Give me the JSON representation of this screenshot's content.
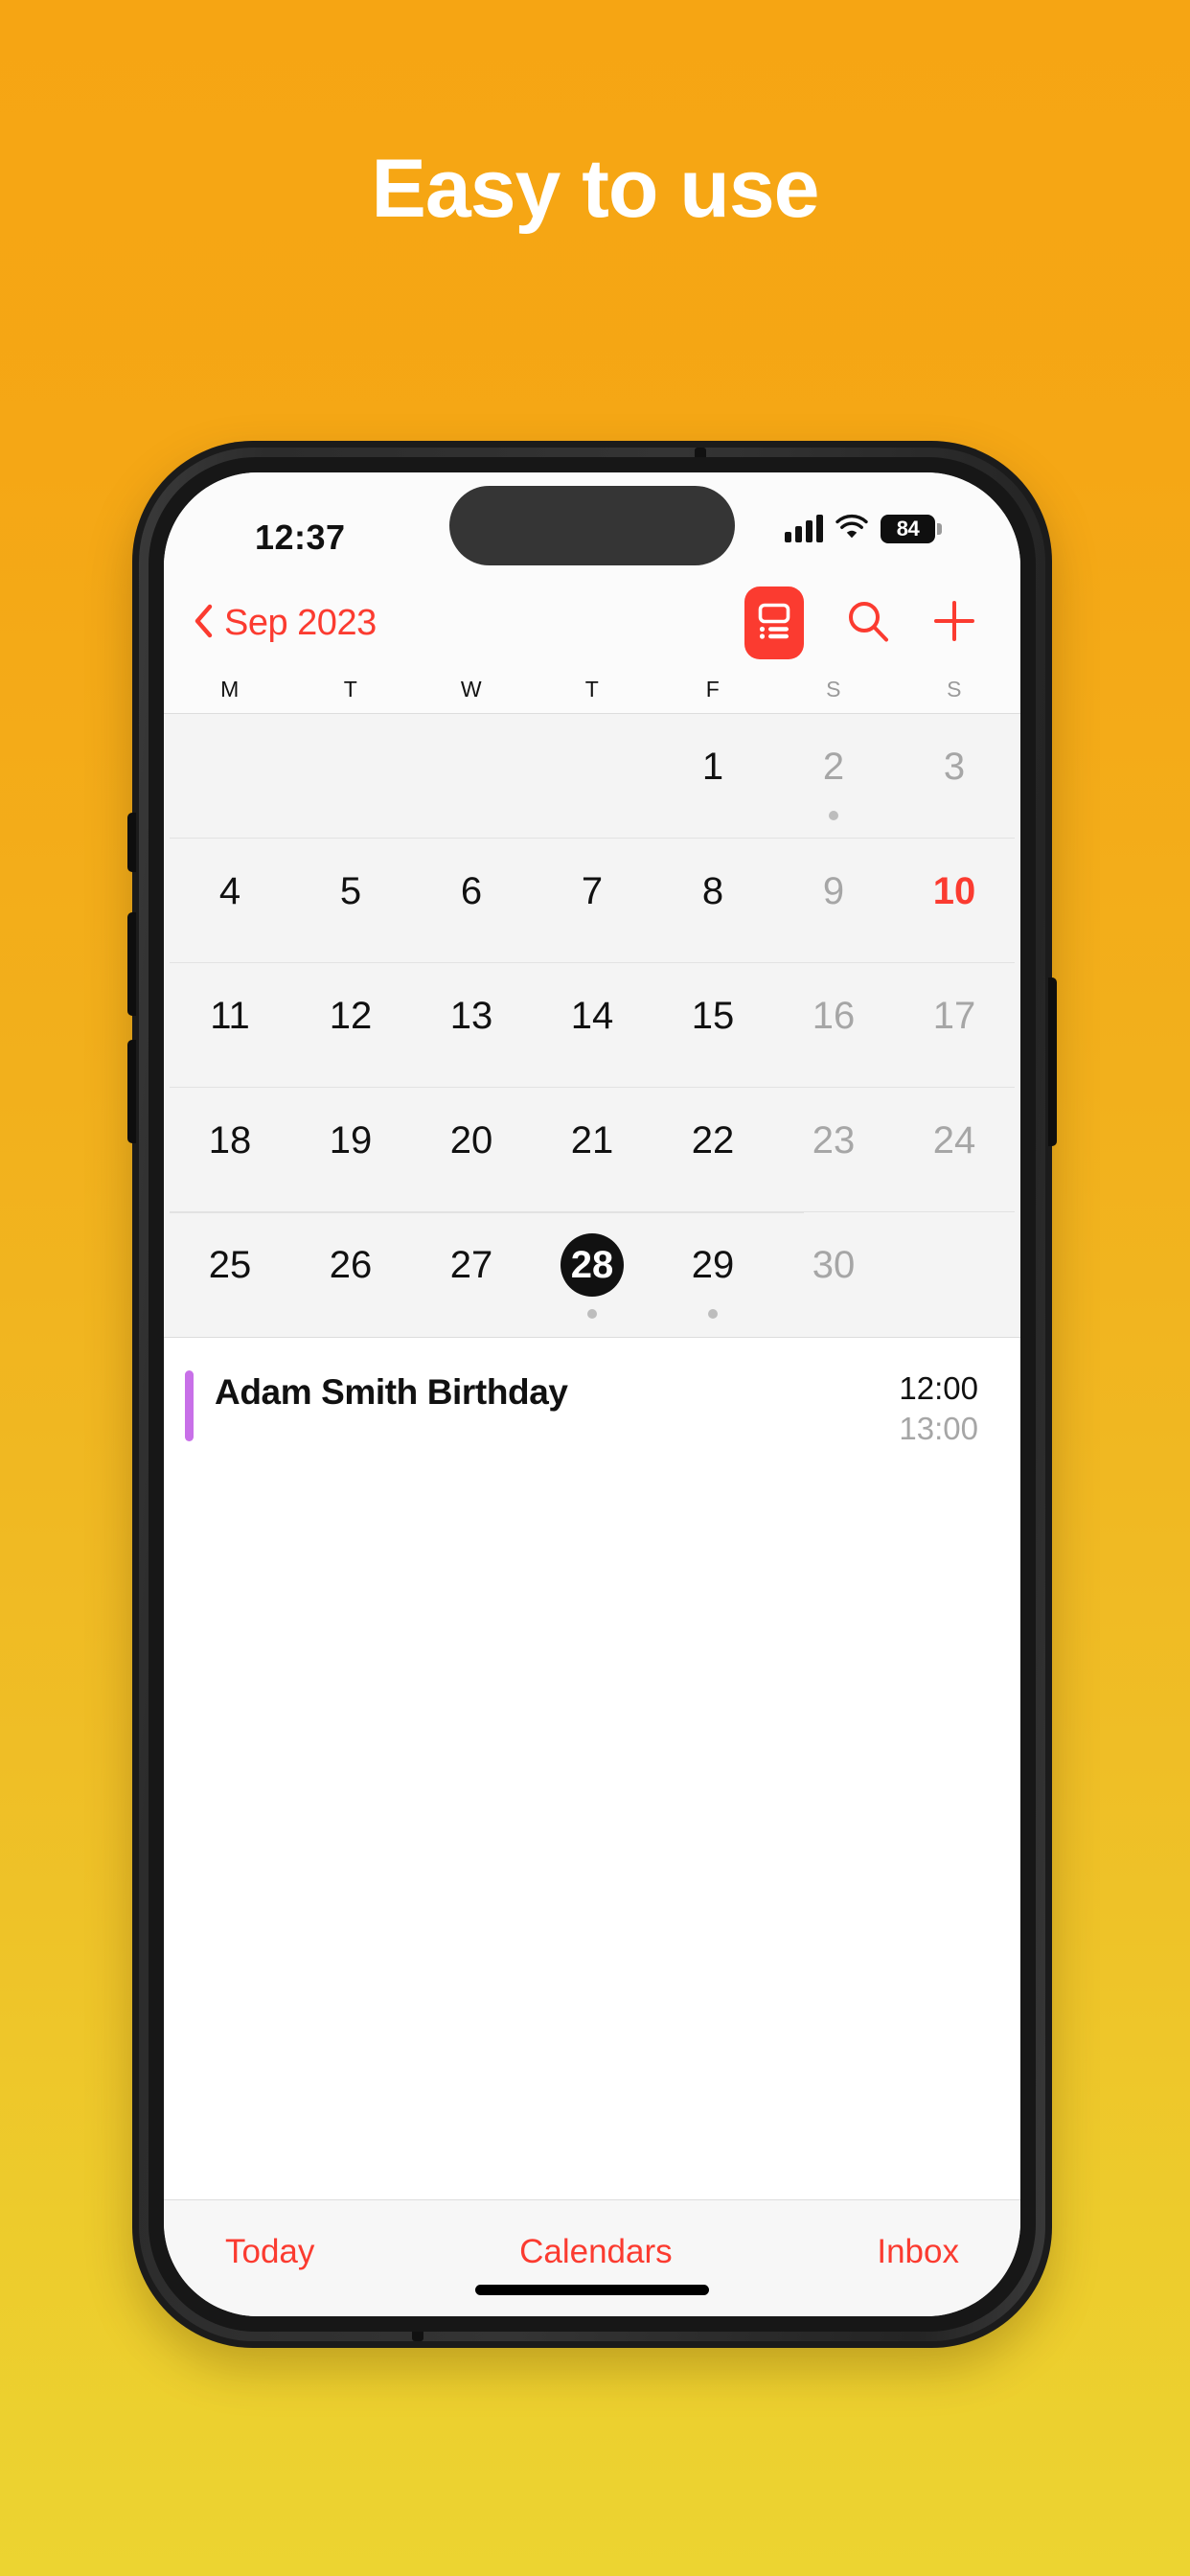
{
  "promo": {
    "headline": "Easy to use",
    "bg_top_color": "#F6A513",
    "bg_bottom_color": "#ECD431"
  },
  "phone": {
    "frame_color": "#1b1b1b",
    "buttons": {
      "mute": "mute-switch",
      "volume_up": "volume-up",
      "volume_down": "volume-down",
      "power": "power"
    }
  },
  "status_bar": {
    "time": "12:37",
    "cellular_icon": "cellular-bars-icon",
    "wifi_icon": "wifi-icon",
    "battery_percent": "84",
    "battery_icon": "battery-icon"
  },
  "nav": {
    "back_icon": "chevron-left-icon",
    "month_label": "Sep 2023",
    "list_view_icon": "list-detail-icon",
    "search_icon": "search-icon",
    "add_icon": "plus-icon",
    "accent_color": "#FB3B30"
  },
  "calendar": {
    "weekdays": [
      {
        "label": "M",
        "weekend": false
      },
      {
        "label": "T",
        "weekend": false
      },
      {
        "label": "W",
        "weekend": false
      },
      {
        "label": "T",
        "weekend": false
      },
      {
        "label": "F",
        "weekend": false
      },
      {
        "label": "S",
        "weekend": true
      },
      {
        "label": "S",
        "weekend": true
      }
    ],
    "weeks": [
      [
        {
          "day": "",
          "state": "empty",
          "dot": false
        },
        {
          "day": "",
          "state": "empty",
          "dot": false
        },
        {
          "day": "",
          "state": "empty",
          "dot": false
        },
        {
          "day": "",
          "state": "empty",
          "dot": false
        },
        {
          "day": "1",
          "state": "normal",
          "dot": false
        },
        {
          "day": "2",
          "state": "dim",
          "dot": true
        },
        {
          "day": "3",
          "state": "dim",
          "dot": false
        }
      ],
      [
        {
          "day": "4",
          "state": "normal",
          "dot": false
        },
        {
          "day": "5",
          "state": "normal",
          "dot": false
        },
        {
          "day": "6",
          "state": "normal",
          "dot": false
        },
        {
          "day": "7",
          "state": "normal",
          "dot": false
        },
        {
          "day": "8",
          "state": "normal",
          "dot": false
        },
        {
          "day": "9",
          "state": "dim",
          "dot": false
        },
        {
          "day": "10",
          "state": "today",
          "dot": false
        }
      ],
      [
        {
          "day": "11",
          "state": "normal",
          "dot": false
        },
        {
          "day": "12",
          "state": "normal",
          "dot": false
        },
        {
          "day": "13",
          "state": "normal",
          "dot": false
        },
        {
          "day": "14",
          "state": "normal",
          "dot": false
        },
        {
          "day": "15",
          "state": "normal",
          "dot": false
        },
        {
          "day": "16",
          "state": "dim",
          "dot": false
        },
        {
          "day": "17",
          "state": "dim",
          "dot": false
        }
      ],
      [
        {
          "day": "18",
          "state": "normal",
          "dot": false
        },
        {
          "day": "19",
          "state": "normal",
          "dot": false
        },
        {
          "day": "20",
          "state": "normal",
          "dot": false
        },
        {
          "day": "21",
          "state": "normal",
          "dot": false
        },
        {
          "day": "22",
          "state": "normal",
          "dot": false
        },
        {
          "day": "23",
          "state": "dim",
          "dot": false
        },
        {
          "day": "24",
          "state": "dim",
          "dot": false
        }
      ],
      [
        {
          "day": "25",
          "state": "normal",
          "dot": false
        },
        {
          "day": "26",
          "state": "normal",
          "dot": false
        },
        {
          "day": "27",
          "state": "normal",
          "dot": false
        },
        {
          "day": "28",
          "state": "selected",
          "dot": true
        },
        {
          "day": "29",
          "state": "normal",
          "dot": true
        },
        {
          "day": "30",
          "state": "dim",
          "dot": false
        },
        {
          "day": "",
          "state": "empty",
          "dot": false
        }
      ]
    ],
    "selected_day": "28",
    "today": "10"
  },
  "events": [
    {
      "title": "Adam Smith Birthday",
      "start_time": "12:00",
      "end_time": "13:00",
      "color": "#C870E8"
    }
  ],
  "toolbar": {
    "today_label": "Today",
    "calendars_label": "Calendars",
    "inbox_label": "Inbox"
  }
}
